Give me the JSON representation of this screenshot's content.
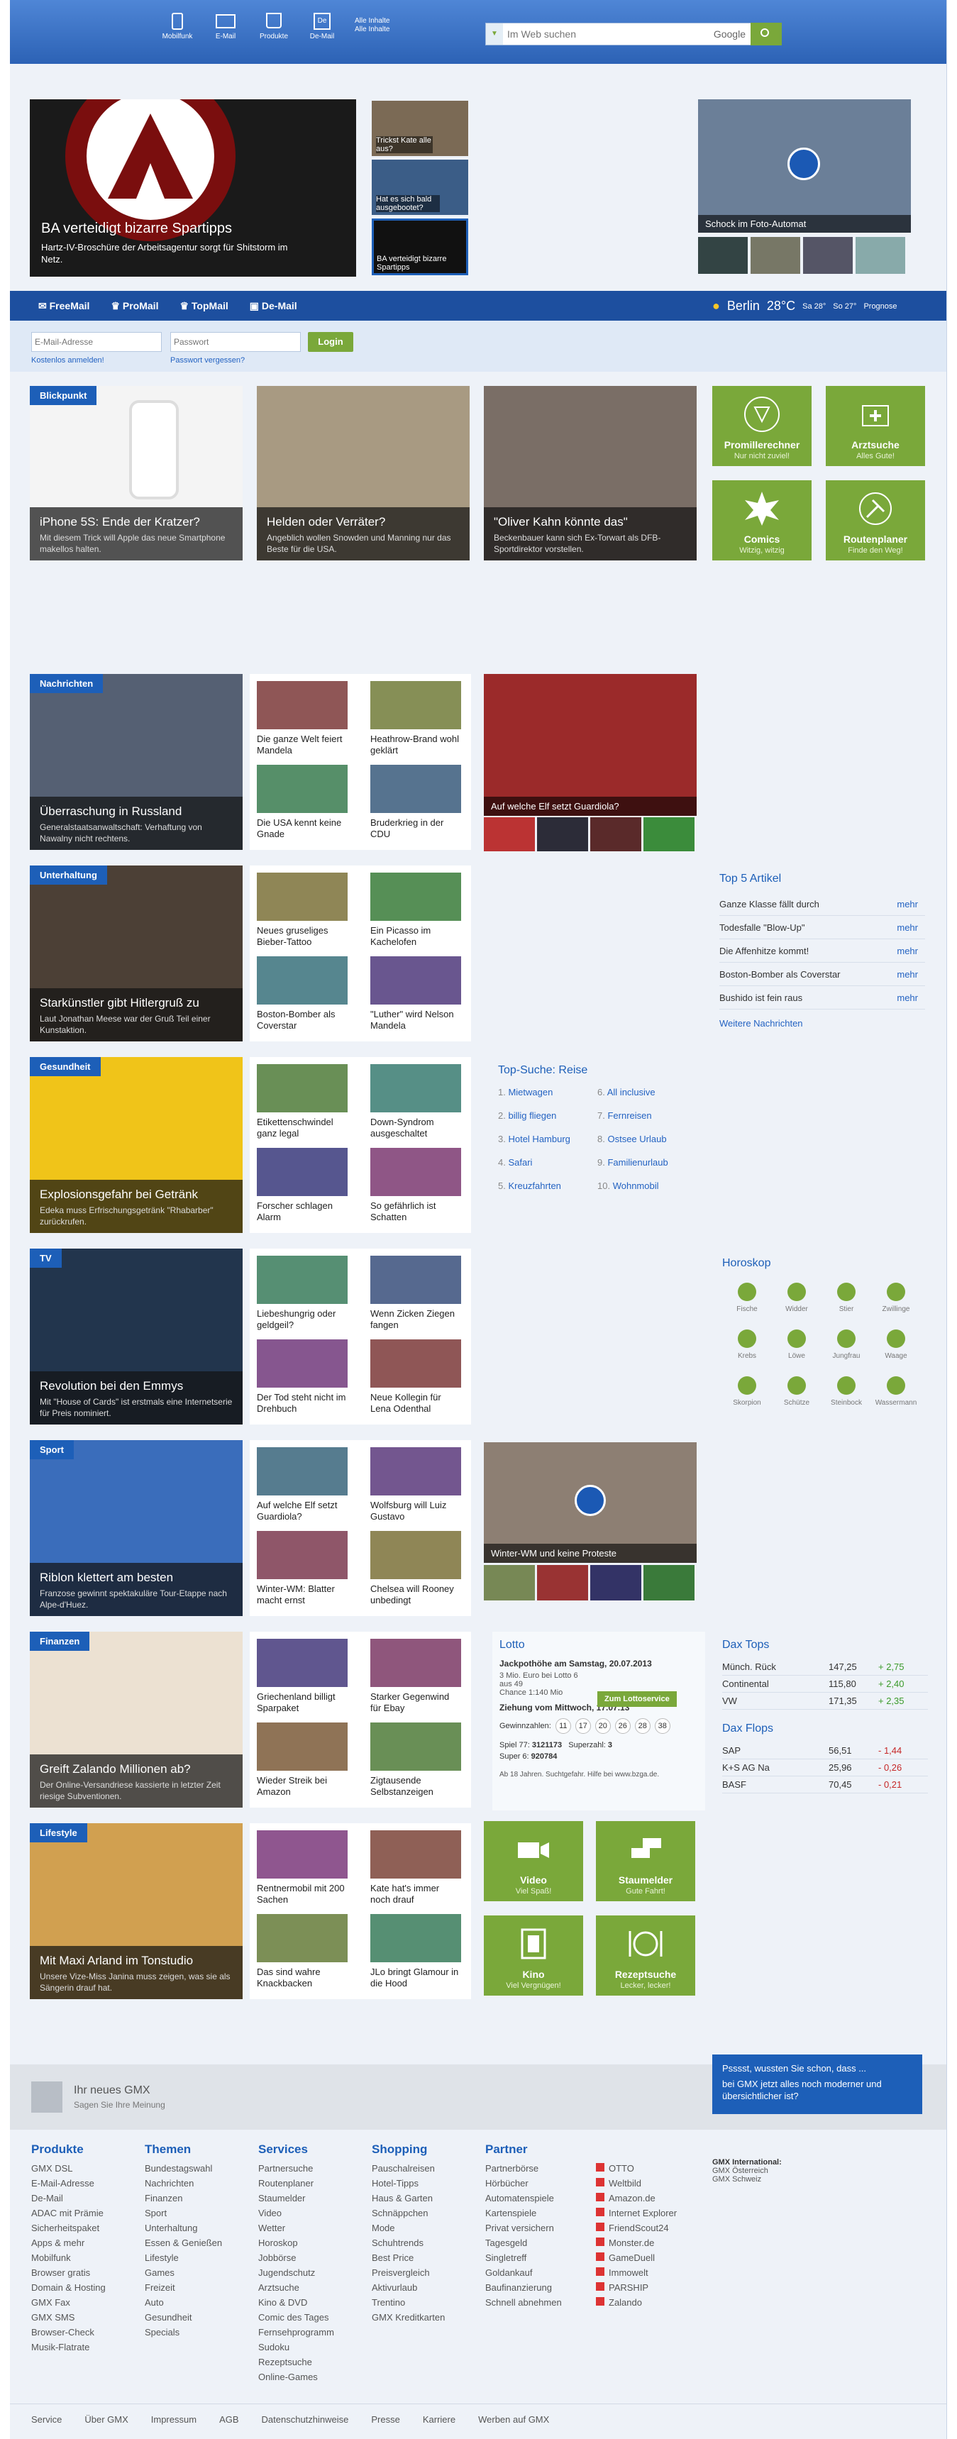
{
  "header": {
    "icons": [
      {
        "label": "Mobilfunk",
        "icon": "phone-icon"
      },
      {
        "label": "E-Mail",
        "icon": "mail-icon"
      },
      {
        "label": "Produkte",
        "icon": "bag-icon"
      },
      {
        "label": "De-Mail",
        "icon": "demail-icon"
      }
    ],
    "alle": "Alle Inhalte",
    "search_placeholder": "Im Web suchen",
    "search_brand": "Google"
  },
  "hero": {
    "title": "BA verteidigt bizarre Spartipps",
    "desc": "Hartz-IV-Broschüre der Arbeitsagentur sorgt für Shitstorm im Netz.",
    "thumbs": [
      "Trickst Kate alle aus?",
      "Hat es sich bald ausgebootet?",
      "BA verteidigt bizarre Spartipps"
    ],
    "video_caption": "Schock im Foto-Automat"
  },
  "mailbar": {
    "tabs": [
      "FreeMail",
      "ProMail",
      "TopMail",
      "De-Mail"
    ],
    "city": "Berlin",
    "temp": "28°C",
    "sa": "Sa 28°",
    "so": "So 27°",
    "prognose": "Prognose",
    "email_placeholder": "E-Mail-Adresse",
    "password_placeholder": "Passwort",
    "login": "Login",
    "register": "Kostenlos anmelden!",
    "forgot": "Passwort vergessen?"
  },
  "blickpunkt": {
    "label": "Blickpunkt",
    "items": [
      {
        "t": "iPhone 5S: Ende der Kratzer?",
        "d": "Mit diesem Trick will Apple das neue Smartphone makellos halten."
      },
      {
        "t": "Helden oder Verräter?",
        "d": "Angeblich wollen Snowden und Manning nur das Beste für die USA."
      },
      {
        "t": "\"Oliver Kahn könnte das\"",
        "d": "Beckenbauer kann sich Ex-Torwart als DFB-Sportdirektor vorstellen."
      }
    ]
  },
  "tiles_top": [
    {
      "t": "Promillerechner",
      "s": "Nur nicht zuviel!"
    },
    {
      "t": "Arztsuche",
      "s": "Alles Gute!"
    },
    {
      "t": "Comics",
      "s": "Witzig, witzig"
    },
    {
      "t": "Routenplaner",
      "s": "Finde den Weg!"
    }
  ],
  "sections": [
    {
      "label": "Nachrichten",
      "t": "Überraschung in Russland",
      "d": "Generalstaatsanwaltschaft: Verhaftung von Nawalny nicht rechtens.",
      "smalls": [
        "Die ganze Welt feiert Mandela",
        "Heathrow-Brand wohl geklärt",
        "Die USA kennt keine Gnade",
        "Bruderkrieg in der CDU"
      ]
    },
    {
      "label": "Unterhaltung",
      "t": "Starkünstler gibt Hitlergruß zu",
      "d": "Laut Jonathan Meese war der Gruß Teil einer Kunstaktion.",
      "smalls": [
        "Neues gruseliges Bieber-Tattoo",
        "Ein Picasso im Kachelofen",
        "Boston-Bomber als Coverstar",
        "\"Luther\" wird Nelson Mandela"
      ]
    },
    {
      "label": "Gesundheit",
      "t": "Explosionsgefahr bei Getränk",
      "d": "Edeka muss Erfrischungsgetränk \"Rhabarber\" zurückrufen.",
      "smalls": [
        "Etikettenschwindel ganz legal",
        "Down-Syndrom ausgeschaltet",
        "Forscher schlagen Alarm",
        "So gefährlich ist Schatten"
      ]
    },
    {
      "label": "TV",
      "t": "Revolution bei den Emmys",
      "d": "Mit \"House of Cards\" ist erstmals eine Internetserie für Preis nominiert.",
      "smalls": [
        "Liebeshungrig oder geldgeil?",
        "Wenn Zicken Ziegen fangen",
        "Der Tod steht nicht im Drehbuch",
        "Neue Kollegin für Lena Odenthal"
      ]
    },
    {
      "label": "Sport",
      "t": "Riblon klettert am besten",
      "d": "Franzose gewinnt spektakuläre Tour-Etappe nach Alpe-d'Huez.",
      "smalls": [
        "Auf welche Elf setzt Guardiola?",
        "Wolfsburg will Luiz Gustavo",
        "Winter-WM: Blatter macht ernst",
        "Chelsea will Rooney unbedingt"
      ]
    },
    {
      "label": "Finanzen",
      "t": "Greift Zalando Millionen ab?",
      "d": "Der Online-Versandriese kassierte in letzter Zeit riesige Subventionen.",
      "smalls": [
        "Griechenland billigt Sparpaket",
        "Starker Gegenwind für Ebay",
        "Wieder Streik bei Amazon",
        "Zigtausende Selbstanzeigen"
      ]
    },
    {
      "label": "Lifestyle",
      "t": "Mit Maxi Arland im Tonstudio",
      "d": "Unsere Vize-Miss Janina muss zeigen, was sie als Sängerin drauf hat.",
      "smalls": [
        "Rentnermobil mit 200 Sachen",
        "Kate hat's immer noch drauf",
        "Das sind wahre Knackbacken",
        "JLo bringt Glamour in die Hood"
      ]
    }
  ],
  "sport_gallery_caption": "Auf welche Elf setzt Guardiola?",
  "wm_caption": "Winter-WM und keine Proteste",
  "top5": {
    "title": "Top 5 Artikel",
    "items": [
      "Ganze Klasse fällt durch",
      "Todesfalle \"Blow-Up\"",
      "Die Affenhitze kommt!",
      "Boston-Bomber als Coverstar",
      "Bushido ist fein raus"
    ],
    "more": "mehr",
    "next": "Weitere Nachrichten"
  },
  "topsuche": {
    "title": "Top-Suche: Reise",
    "items": [
      "Mietwagen",
      "billig fliegen",
      "Hotel Hamburg",
      "Safari",
      "Kreuzfahrten",
      "All inclusive",
      "Fernreisen",
      "Ostsee Urlaub",
      "Familienurlaub",
      "Wohnmobil"
    ]
  },
  "horoskop": {
    "title": "Horoskop",
    "signs": [
      "Fische",
      "Widder",
      "Stier",
      "Zwillinge",
      "Krebs",
      "Löwe",
      "Jungfrau",
      "Waage",
      "Skorpion",
      "Schütze",
      "Steinbock",
      "Wassermann"
    ]
  },
  "lotto": {
    "title": "Lotto",
    "jackpot": "Jackpothöhe am Samstag, 20.07.2013",
    "jp_desc": "3 Mio. Euro bei Lotto 6 aus 49",
    "chance": "Chance 1:140 Mio",
    "btn": "Zum Lottoservice",
    "ziehung": "Ziehung vom Mittwoch, 17.07.13",
    "gz": "Gewinnzahlen:",
    "numbers": [
      "11",
      "17",
      "20",
      "26",
      "28",
      "38"
    ],
    "spiel77": "Spiel 77:",
    "spiel77v": "3121173",
    "superzahl": "Superzahl:",
    "superzahlv": "3",
    "super6": "Super 6:",
    "super6v": "920784",
    "hint": "Ab 18 Jahren. Suchtgefahr. Hilfe bei www.bzga.de."
  },
  "dax_tops": {
    "title": "Dax Tops",
    "rows": [
      [
        "Münch. Rück",
        "147,25",
        "+ 2,75"
      ],
      [
        "Continental",
        "115,80",
        "+ 2,40"
      ],
      [
        "VW",
        "171,35",
        "+ 2,35"
      ]
    ]
  },
  "dax_flops": {
    "title": "Dax Flops",
    "rows": [
      [
        "SAP",
        "56,51",
        "- 1,44"
      ],
      [
        "K+S AG Na",
        "25,96",
        "- 0,26"
      ],
      [
        "BASF",
        "70,45",
        "- 0,21"
      ]
    ]
  },
  "tiles_bottom": [
    {
      "t": "Video",
      "s": "Viel Spaß!"
    },
    {
      "t": "Staumelder",
      "s": "Gute Fahrt!"
    },
    {
      "t": "Kino",
      "s": "Viel Vergnügen!"
    },
    {
      "t": "Rezeptsuche",
      "s": "Lecker, lecker!"
    }
  ],
  "neues": {
    "title": "Ihr neues GMX",
    "sub": "Sagen Sie Ihre Meinung",
    "bubble_t": "Psssst, wussten Sie schon, dass ...",
    "bubble_d": "bei GMX jetzt alles noch moderner und übersichtlicher ist?"
  },
  "footer": {
    "cols": [
      {
        "h": "Produkte",
        "items": [
          "GMX DSL",
          "E-Mail-Adresse",
          "De-Mail",
          "ADAC mit Prämie",
          "Sicherheitspaket",
          "Apps & mehr",
          "Mobilfunk",
          "Browser gratis",
          "Domain & Hosting",
          "GMX Fax",
          "GMX SMS",
          "Browser-Check",
          "Musik-Flatrate"
        ]
      },
      {
        "h": "Themen",
        "items": [
          "Bundestagswahl",
          "Nachrichten",
          "Finanzen",
          "Sport",
          "Unterhaltung",
          "Essen & Genießen",
          "Lifestyle",
          "Games",
          "Freizeit",
          "Auto",
          "Gesundheit",
          "Specials"
        ]
      },
      {
        "h": "Services",
        "items": [
          "Partnersuche",
          "Routenplaner",
          "Staumelder",
          "Video",
          "Wetter",
          "Horoskop",
          "Jobbörse",
          "Jugendschutz",
          "Arztsuche",
          "Kino & DVD",
          "Comic des Tages",
          "Fernsehprogramm",
          "Sudoku",
          "Rezeptsuche",
          "Online-Games"
        ]
      },
      {
        "h": "Shopping",
        "items": [
          "Pauschalreisen",
          "Hotel-Tipps",
          "Haus & Garten",
          "Schnäppchen",
          "Mode",
          "Schuhtrends",
          "Best Price",
          "Preisvergleich",
          "Aktivurlaub",
          "Trentino",
          "GMX Kreditkarten"
        ]
      },
      {
        "h": "Partner",
        "items": [
          "Partnerbörse",
          "Hörbücher",
          "Automatenspiele",
          "Kartenspiele",
          "Privat versichern",
          "Tagesgeld",
          "Singletreff",
          "Goldankauf",
          "Baufinanzierung",
          "Schnell abnehmen"
        ]
      }
    ],
    "brands": [
      "OTTO",
      "Weltbild",
      "Amazon.de",
      "Internet Explorer",
      "FriendScout24",
      "Monster.de",
      "GameDuell",
      "Immowelt",
      "PARSHIP",
      "Zalando"
    ],
    "intl_h": "GMX International:",
    "intl": [
      "GMX Österreich",
      "GMX Schweiz"
    ],
    "bottom": [
      "Service",
      "Über GMX",
      "Impressum",
      "AGB",
      "Datenschutzhinweise",
      "Presse",
      "Karriere",
      "Werben auf GMX"
    ]
  },
  "colors": {
    "blue": "#1d5fb8",
    "green": "#7aa83a",
    "navbg": "#3d75c6"
  }
}
